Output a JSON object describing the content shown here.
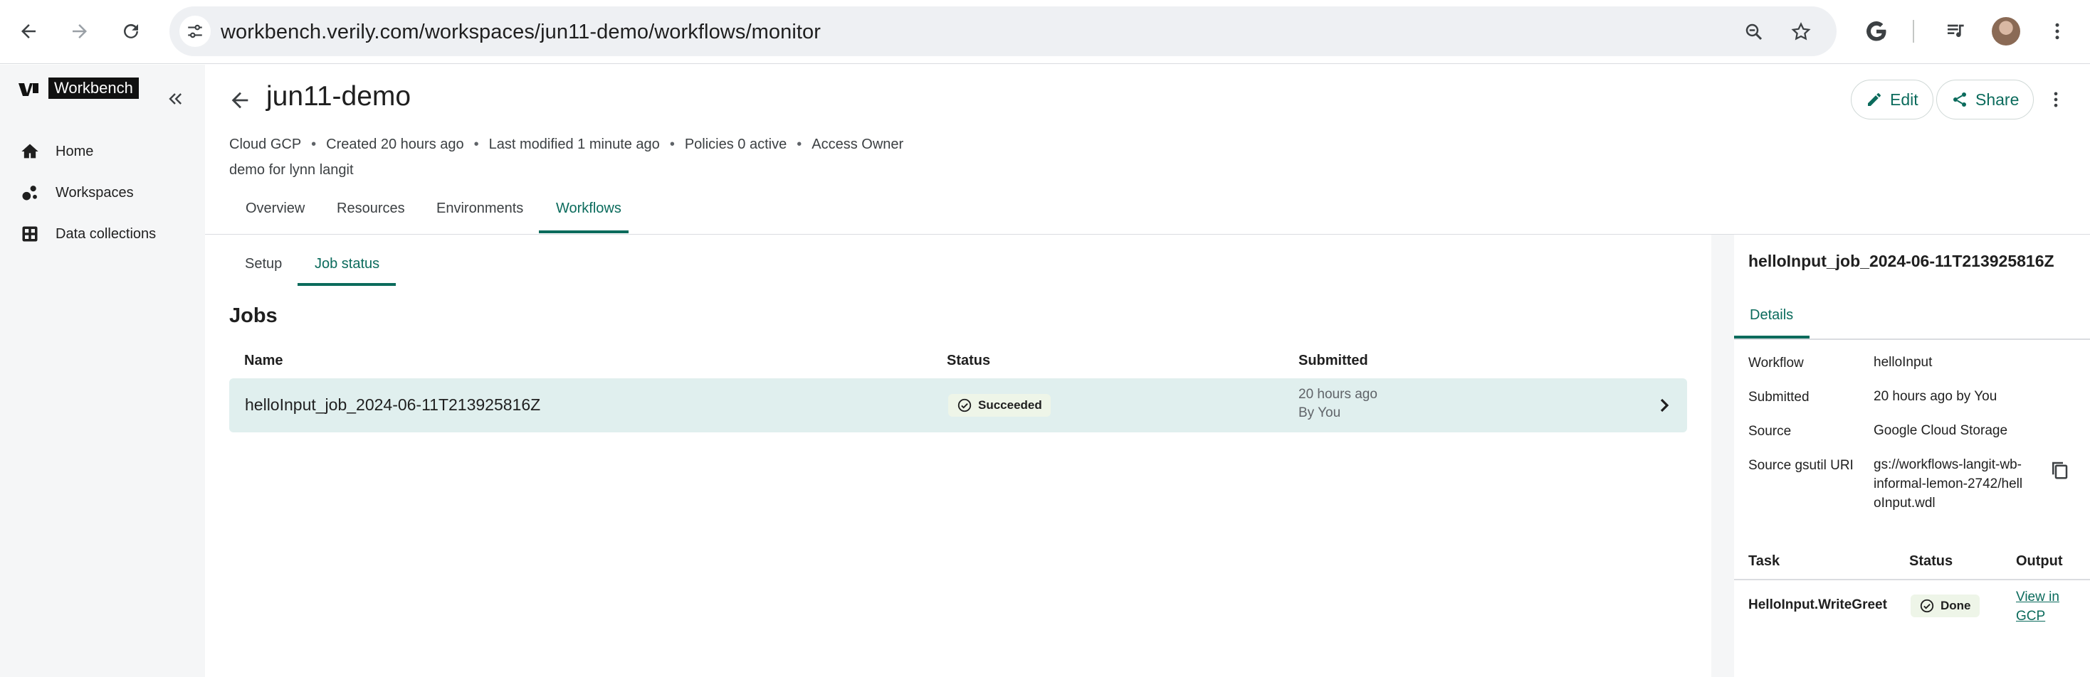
{
  "browser": {
    "url": "workbench.verily.com/workspaces/jun11-demo/workflows/monitor"
  },
  "sidebar": {
    "logo_text": "Workbench",
    "items": [
      {
        "label": "Home",
        "icon": "home-icon"
      },
      {
        "label": "Workspaces",
        "icon": "workspaces-icon"
      },
      {
        "label": "Data collections",
        "icon": "grid-icon"
      }
    ]
  },
  "workspace": {
    "title": "jun11-demo",
    "meta": {
      "cloud": "Cloud GCP",
      "created": "Created 20 hours ago",
      "modified": "Last modified 1 minute ago",
      "policies": "Policies 0 active",
      "access": "Access Owner"
    },
    "description": "demo for lynn langit",
    "edit_label": "Edit",
    "share_label": "Share"
  },
  "tabs": [
    "Overview",
    "Resources",
    "Environments",
    "Workflows"
  ],
  "active_tab": "Workflows",
  "subtabs": [
    "Setup",
    "Job status"
  ],
  "active_subtab": "Job status",
  "jobs": {
    "heading": "Jobs",
    "columns": [
      "Name",
      "Status",
      "Submitted"
    ],
    "rows": [
      {
        "name": "helloInput_job_2024-06-11T213925816Z",
        "status": "Succeeded",
        "submitted": "20 hours ago",
        "submitted_by": "By You"
      }
    ]
  },
  "detail": {
    "title": "helloInput_job_2024-06-11T213925816Z",
    "tab": "Details",
    "fields": [
      {
        "key": "Workflow",
        "value": "helloInput"
      },
      {
        "key": "Submitted",
        "value": "20 hours ago by You"
      },
      {
        "key": "Source",
        "value": "Google Cloud Storage"
      },
      {
        "key": "Source gsutil URI",
        "value_lines": [
          "gs://workflows-langit-wb-",
          "informal-lemon-2742/hell",
          "oInput.wdl"
        ]
      }
    ],
    "task_columns": [
      "Task",
      "Status",
      "Output"
    ],
    "tasks": [
      {
        "task": "HelloInput.WriteGreet",
        "status": "Done",
        "output_lines": [
          "View in",
          "GCP"
        ]
      }
    ]
  },
  "colors": {
    "accent": "#0b6b5c",
    "row_highlight": "#e0efee",
    "sidebar_bg": "#f5f6f7"
  }
}
